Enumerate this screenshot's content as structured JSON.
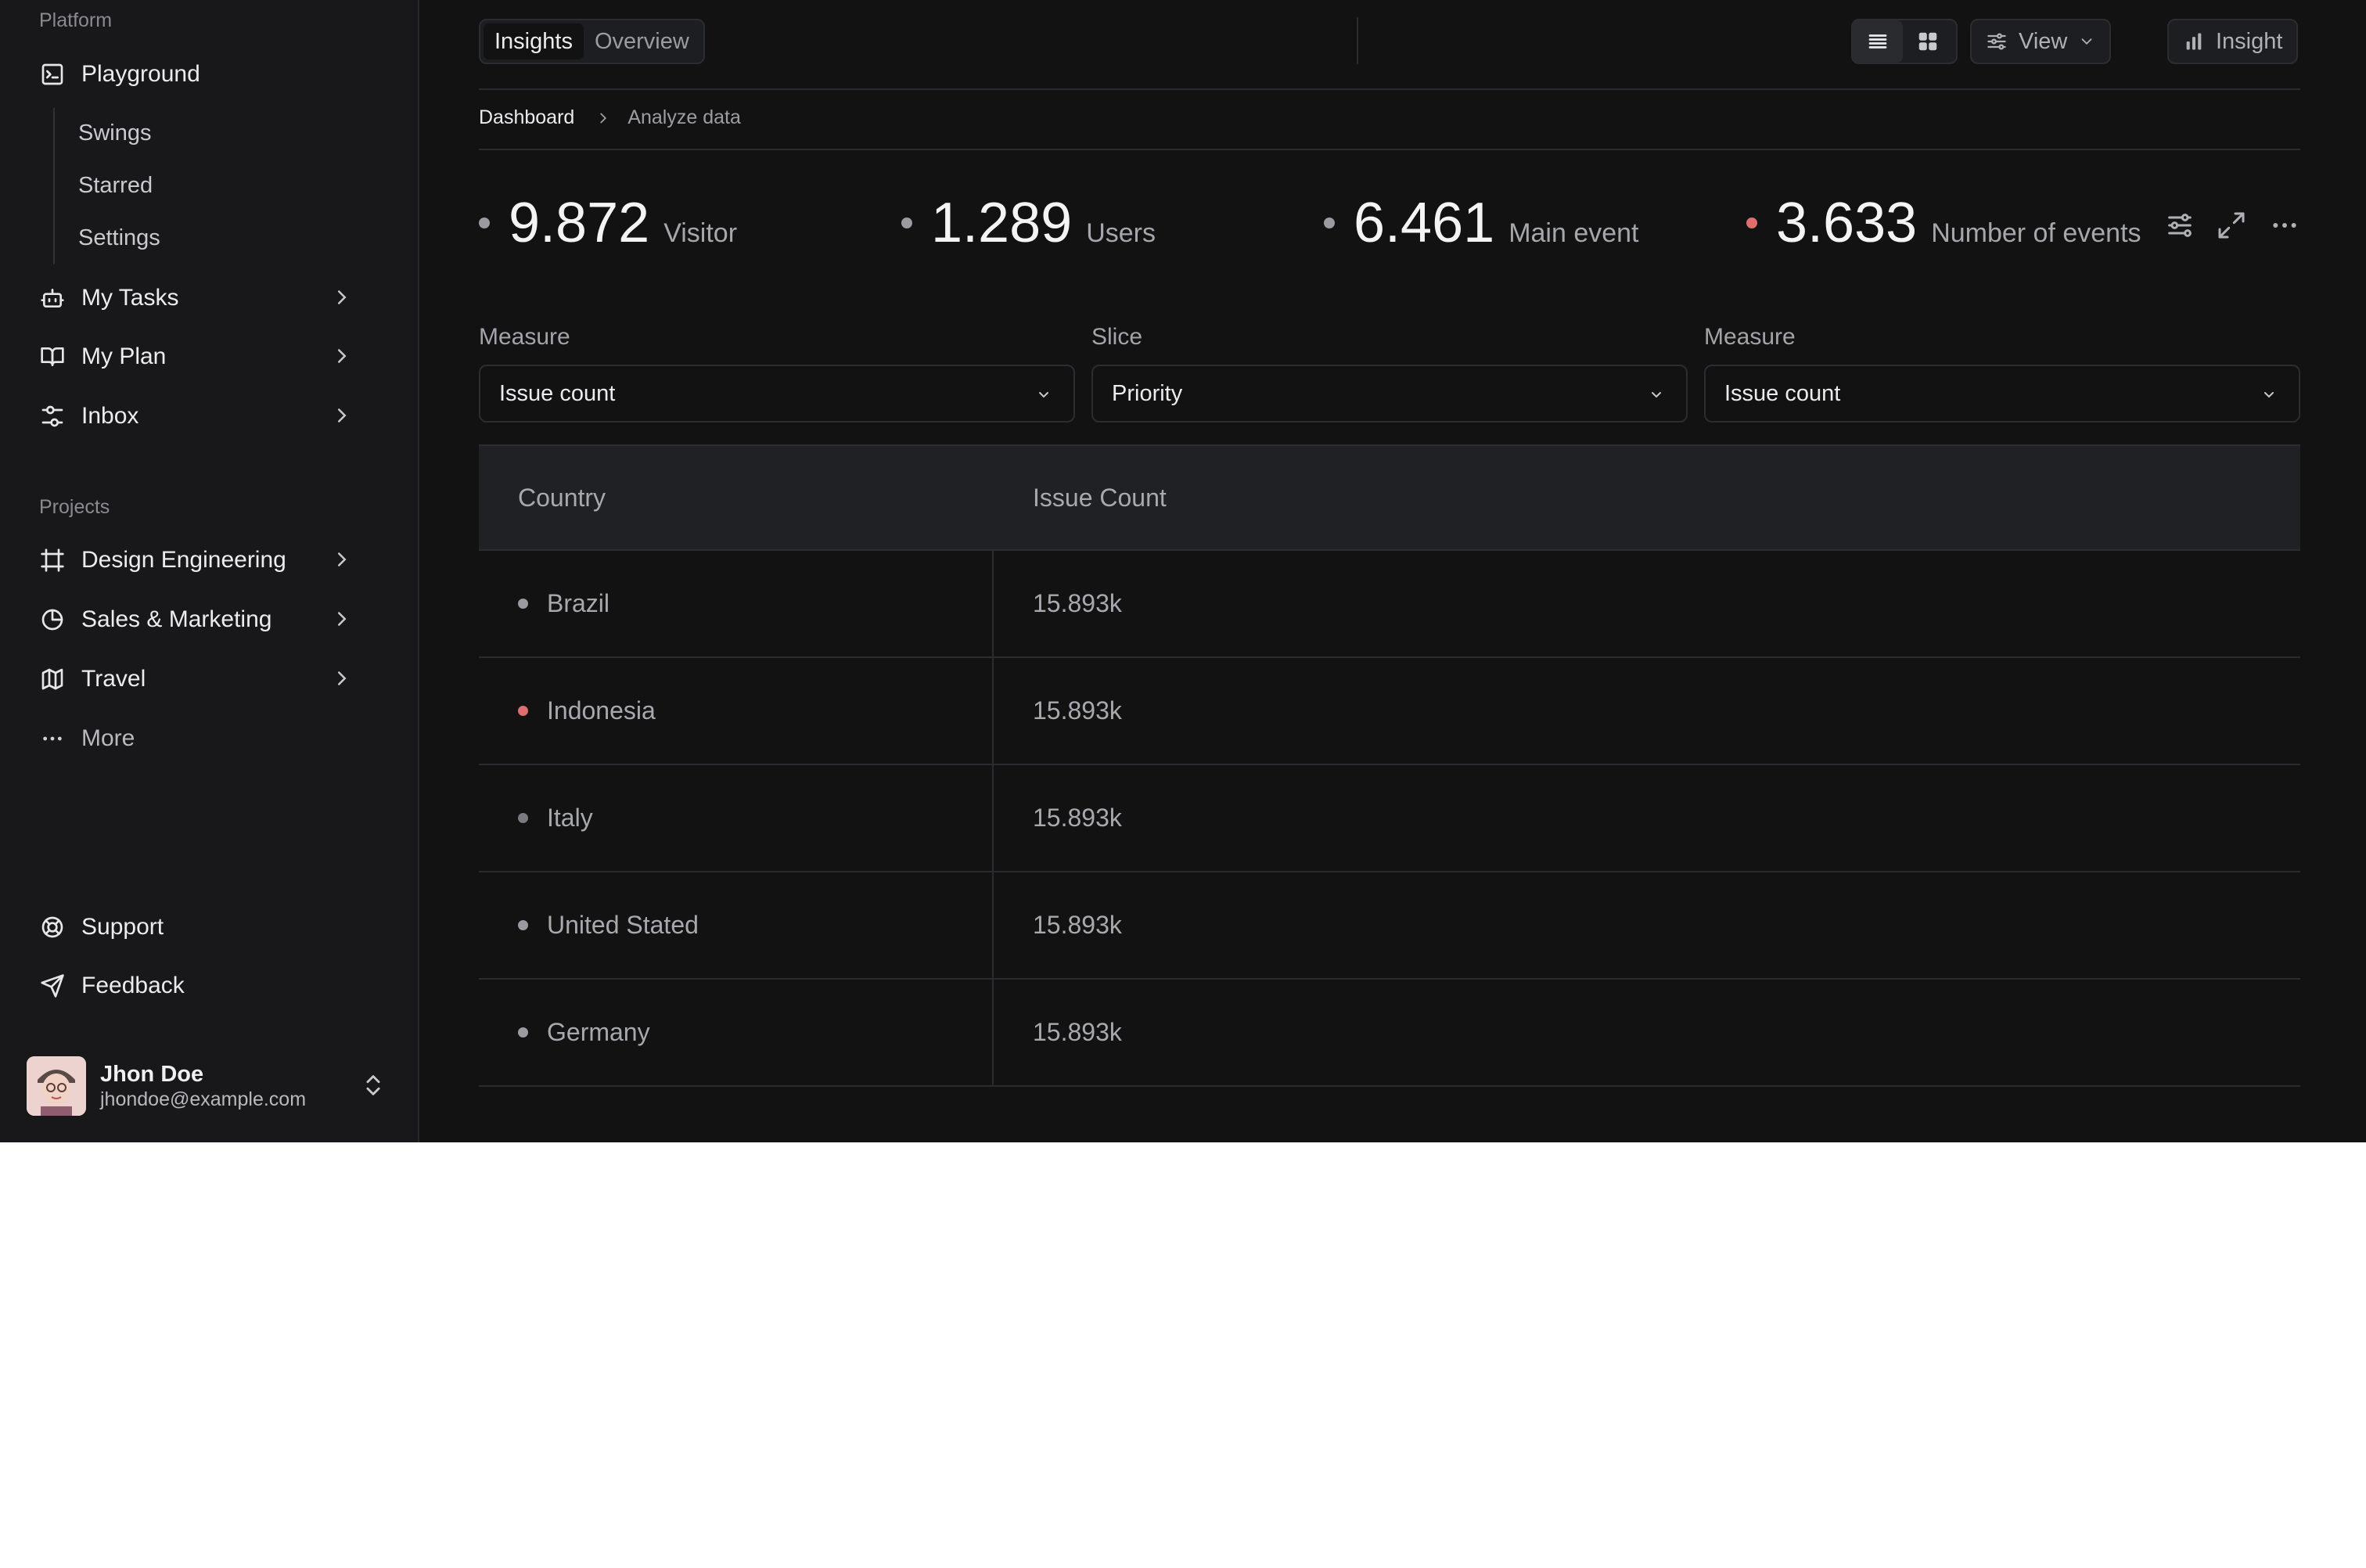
{
  "sidebar": {
    "platform_label": "Platform",
    "platform_items": [
      {
        "label": "Playground",
        "icon": "terminal-square-icon"
      },
      {
        "label": "My Tasks",
        "icon": "bot-icon"
      },
      {
        "label": "My Plan",
        "icon": "book-open-icon"
      },
      {
        "label": "Inbox",
        "icon": "settings-sliders-icon"
      }
    ],
    "sub_items": [
      "Swings",
      "Starred",
      "Settings"
    ],
    "projects_label": "Projects",
    "project_items": [
      {
        "label": "Design Engineering",
        "icon": "frame-icon"
      },
      {
        "label": "Sales & Marketing",
        "icon": "pie-chart-icon"
      },
      {
        "label": "Travel",
        "icon": "map-icon"
      }
    ],
    "more_label": "More",
    "footer_items": [
      {
        "label": "Support",
        "icon": "life-buoy-icon"
      },
      {
        "label": "Feedback",
        "icon": "send-icon"
      }
    ],
    "user": {
      "name": "Jhon Doe",
      "email": "jhondoe@example.com"
    }
  },
  "toolbar": {
    "tabs": [
      {
        "label": "Insights",
        "active": true
      },
      {
        "label": "Overview",
        "active": false
      }
    ],
    "view_label": "View",
    "insight_label": "Insight"
  },
  "breadcrumb": {
    "items": [
      "Dashboard",
      "Analyze data"
    ]
  },
  "stats": [
    {
      "value": "9.872",
      "label": "Visitor",
      "dot": "#9a9ba0"
    },
    {
      "value": "1.289",
      "label": "Users",
      "dot": "#9a9ba0"
    },
    {
      "value": "6.461",
      "label": "Main event",
      "dot": "#9a9ba0"
    },
    {
      "value": "3.633",
      "label": "Number of events",
      "dot": "#e06e6e"
    }
  ],
  "filters": [
    {
      "label": "Measure",
      "value": "Issue count"
    },
    {
      "label": "Slice",
      "value": "Priority"
    },
    {
      "label": "Measure",
      "value": "Issue count"
    }
  ],
  "table": {
    "columns": [
      "Country",
      "Issue Count"
    ],
    "rows": [
      {
        "country": "Brazil",
        "count": "15.893k",
        "dot": "#9a9ba0"
      },
      {
        "country": "Indonesia",
        "count": "15.893k",
        "dot": "#e06e6e"
      },
      {
        "country": "Italy",
        "count": "15.893k",
        "dot": "#7a7b80"
      },
      {
        "country": "United Stated",
        "count": "15.893k",
        "dot": "#9a9ba0"
      },
      {
        "country": "Germany",
        "count": "15.893k",
        "dot": "#9a9ba0"
      }
    ]
  },
  "colors": {
    "background": "#121213",
    "sidebar": "#18181a",
    "accent_red": "#e06e6e"
  }
}
